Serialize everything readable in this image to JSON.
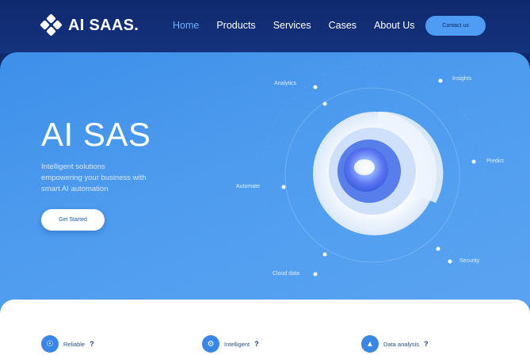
{
  "nav": {
    "brand": "AI SAAS.",
    "links": [
      {
        "label": "Home",
        "active": true
      },
      {
        "label": "Products",
        "active": false
      },
      {
        "label": "Services",
        "active": false
      },
      {
        "label": "Cases",
        "active": false
      },
      {
        "label": "About Us",
        "active": false
      }
    ],
    "cta_label": "Contact us"
  },
  "hero": {
    "title": "AI SAS",
    "description_lines": [
      "Intelligent solutions",
      "empowering your business with",
      "smart AI automation"
    ],
    "button_label": "Get Started",
    "orbit_labels": [
      "Analytics",
      "Insights",
      "Predict",
      "Automate",
      "Cloud data",
      "Security"
    ]
  },
  "features": [
    {
      "icon": "shield-icon",
      "label": "Reliable",
      "mark": "?"
    },
    {
      "icon": "gear-icon",
      "label": "Intelligent",
      "mark": "?"
    },
    {
      "icon": "chart-icon",
      "label": "Data analysis",
      "mark": "?"
    }
  ],
  "colors": {
    "nav_bg": "#102a6e",
    "hero_bg": "#4e9cef",
    "accent": "#69b3ff",
    "cta": "#4f9cf5"
  }
}
